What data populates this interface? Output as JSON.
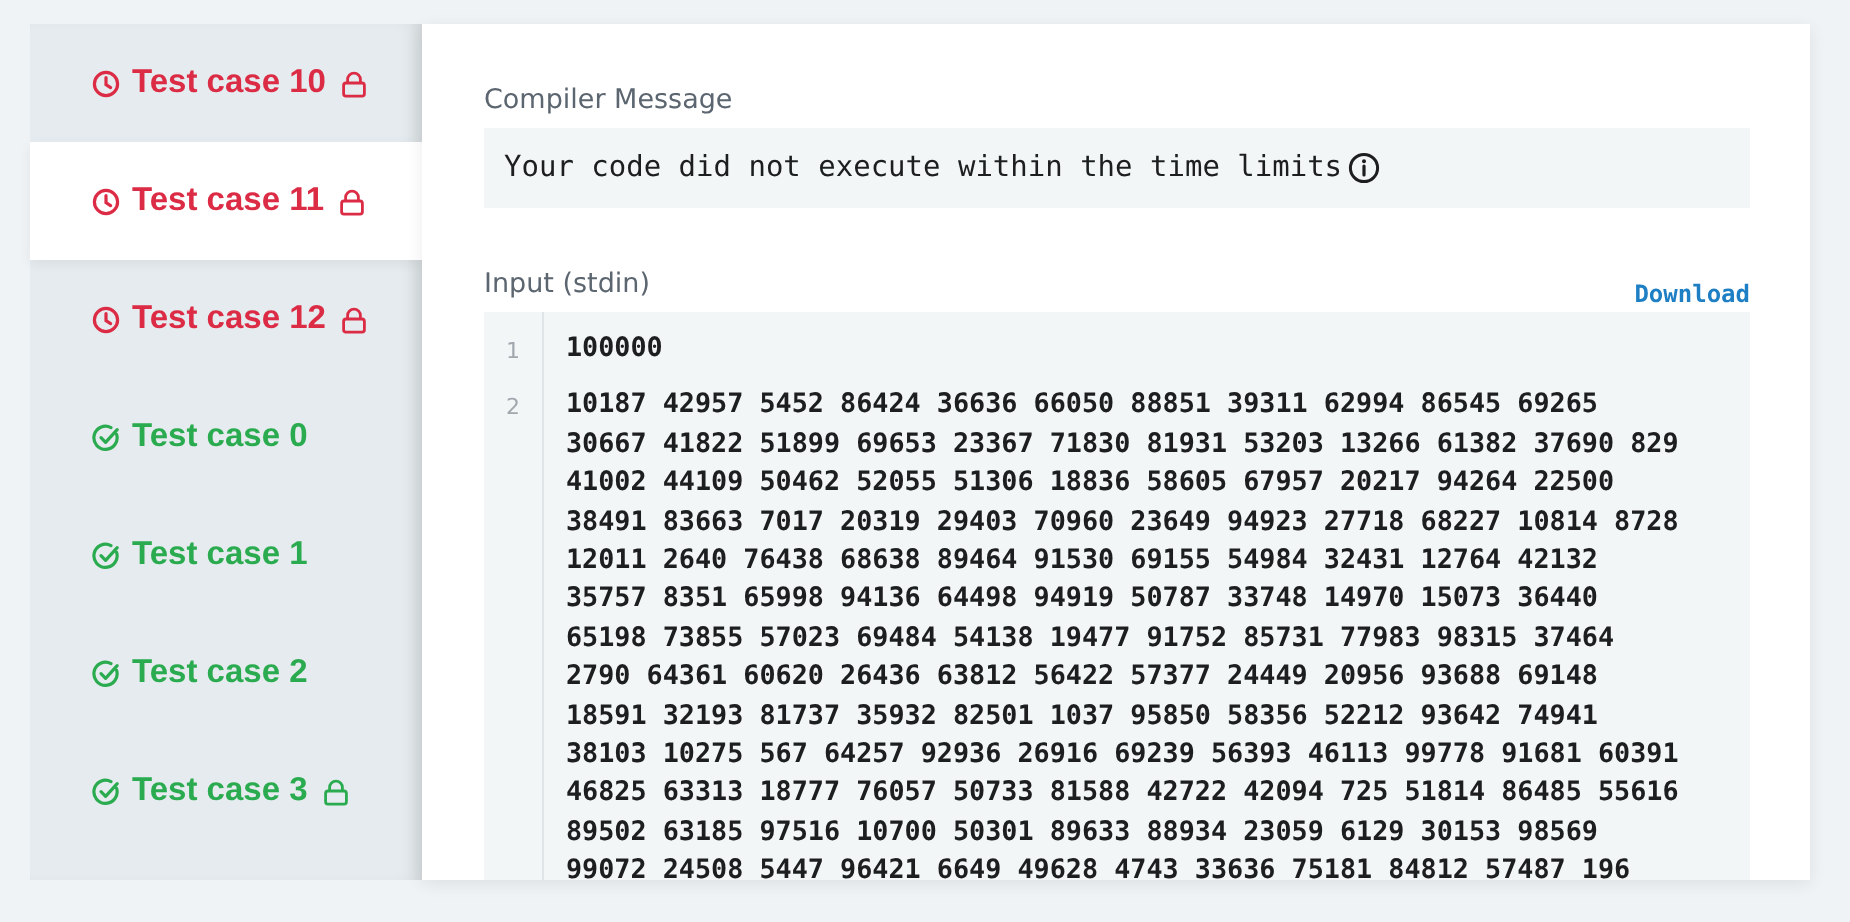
{
  "test_cases": [
    {
      "label": "Test case 10",
      "kind": "timeout",
      "locked": true,
      "selected": false
    },
    {
      "label": "Test case 11",
      "kind": "timeout",
      "locked": true,
      "selected": true
    },
    {
      "label": "Test case 12",
      "kind": "timeout",
      "locked": true,
      "selected": false
    },
    {
      "label": "Test case 0",
      "kind": "passed",
      "locked": false,
      "selected": false
    },
    {
      "label": "Test case 1",
      "kind": "passed",
      "locked": false,
      "selected": false
    },
    {
      "label": "Test case 2",
      "kind": "passed",
      "locked": false,
      "selected": false
    },
    {
      "label": "Test case 3",
      "kind": "passed",
      "locked": true,
      "selected": false
    }
  ],
  "compiler_message": {
    "label": "Compiler Message",
    "text": "Your code did not execute within the time limits"
  },
  "input": {
    "label": "Input (stdin)",
    "download": "Download",
    "lines": [
      {
        "number": "1",
        "rows": [
          "100000"
        ]
      },
      {
        "number": "2",
        "rows": [
          "10187 42957 5452 86424 36636 66050 88851 39311 62994 86545 69265",
          "30667 41822 51899 69653 23367 71830 81931 53203 13266 61382 37690 829",
          "41002 44109 50462 52055 51306 18836 58605 67957 20217 94264 22500",
          "38491 83663 7017 20319 29403 70960 23649 94923 27718 68227 10814 8728",
          "12011 2640 76438 68638 89464 91530 69155 54984 32431 12764 42132",
          "35757 8351 65998 94136 64498 94919 50787 33748 14970 15073 36440",
          "65198 73855 57023 69484 54138 19477 91752 85731 77983 98315 37464",
          "2790 64361 60620 26436 63812 56422 57377 24449 20956 93688 69148",
          "18591 32193 81737 35932 82501 1037 95850 58356 52212 93642 74941",
          "38103 10275 567 64257 92936 26916 69239 56393 46113 99778 91681 60391",
          "46825 63313 18777 76057 50733 81588 42722 42094 725 51814 86485 55616",
          "89502 63185 97516 10700 50301 89633 88934 23059 6129 30153 98569",
          "99072 24508 5447 96421 6649 49628 4743 33636 75181 84812 57487 196"
        ]
      }
    ]
  }
}
